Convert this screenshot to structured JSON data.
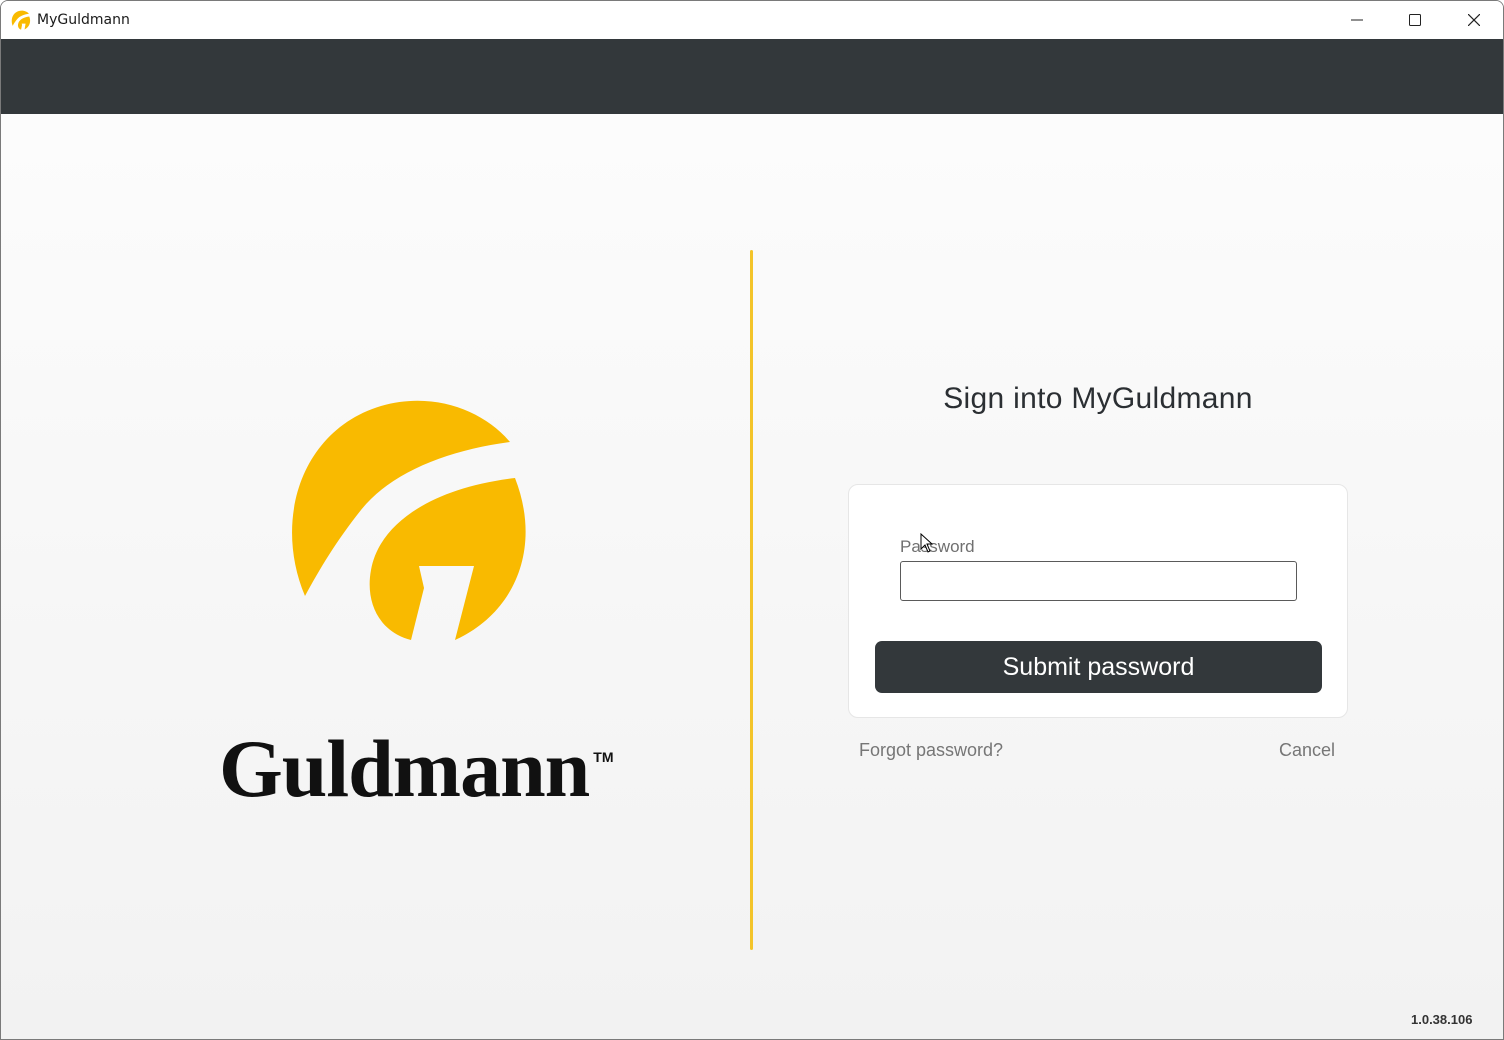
{
  "window": {
    "title": "MyGuldmann",
    "app_icon": "guldmann-logo-icon",
    "controls": [
      "minimize-icon",
      "maximize-icon",
      "close-icon"
    ]
  },
  "brand": {
    "wordmark": "Guldmann",
    "trademark": "TM",
    "accent_color": "#F9BA00",
    "header_color": "#33383B",
    "divider_color": "#F3C42A"
  },
  "signin": {
    "title": "Sign into MyGuldmann",
    "password_label": "Password",
    "password_value": "",
    "submit_label": "Submit password",
    "forgot_label": "Forgot password?",
    "cancel_label": "Cancel"
  },
  "footer": {
    "version": "1.0.38.106"
  }
}
